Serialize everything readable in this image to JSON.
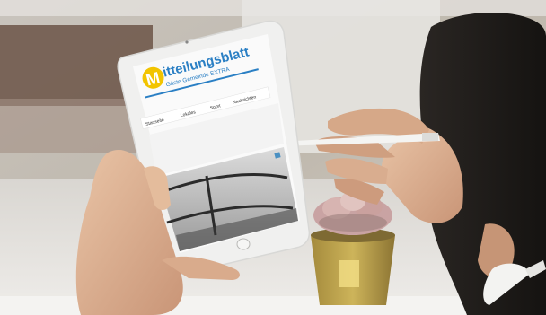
{
  "website": {
    "logo_letter": "M",
    "logo_title": "itteilungsblatt",
    "logo_subtitle": "Gäste Gemeinde EXTRA",
    "nav_items": [
      "Startseite",
      "Lokales",
      "Sport",
      "Nachrichten"
    ]
  },
  "colors": {
    "logo_yellow": "#f2c400",
    "logo_blue": "#2a7fc4"
  }
}
